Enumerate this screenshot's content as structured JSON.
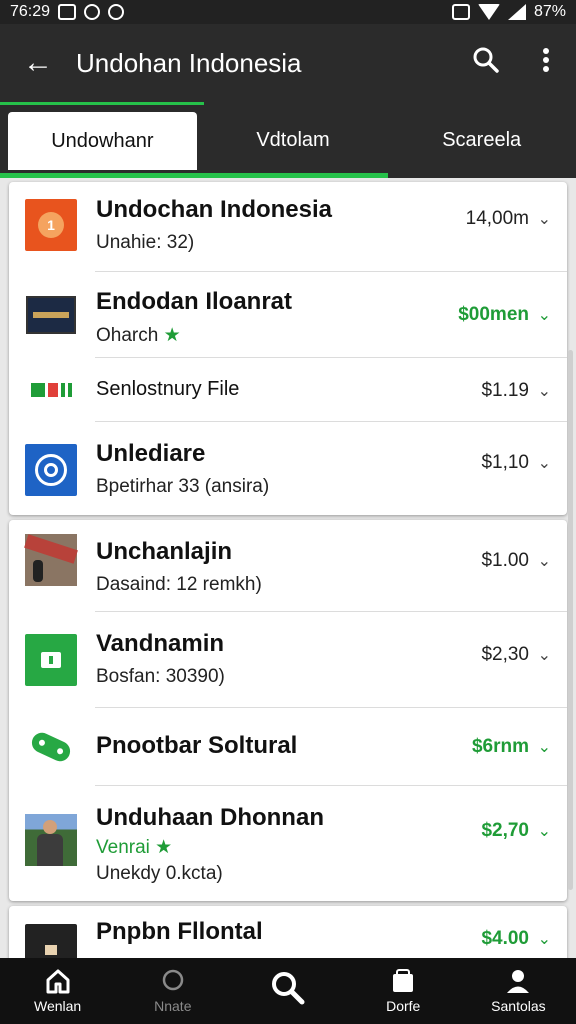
{
  "status": {
    "time": "76:29",
    "battery": "87%"
  },
  "appbar": {
    "title": "Undohan Indonesia"
  },
  "tabs": [
    {
      "label": "Undowhanr"
    },
    {
      "label": "Vdtolam"
    },
    {
      "label": "Scareela"
    }
  ],
  "card1": [
    {
      "name": "Undochan Indonesia",
      "sub": "Unahie: 32)",
      "price": "14,00m",
      "price_color": "normal"
    },
    {
      "name": "Endodan Iloanrat",
      "sub": "Oharch",
      "star": "★",
      "price": "$00men",
      "price_color": "green"
    },
    {
      "name": "Senlostnury File",
      "price": "$1.19",
      "price_color": "normal"
    },
    {
      "name": "Unlediare",
      "sub": "Bpetirhar 33 (ansira)",
      "price": "$1,10",
      "price_color": "normal"
    }
  ],
  "card2": [
    {
      "name": "Unchanlajin",
      "sub": "Dasaind: 12 remkh)",
      "price": "$1.00",
      "price_color": "normal"
    },
    {
      "name": "Vandnamin",
      "sub": "Bosfan: 30390)",
      "price": "$2,30",
      "price_color": "normal"
    },
    {
      "name": "Pnootbar Soltural",
      "price": "$6rnm",
      "price_color": "green"
    },
    {
      "name": "Unduhaan Dhonnan",
      "sub": "Venrai",
      "star": "★",
      "sub2": "Unekdy 0.kcta)",
      "price": "$2,70",
      "price_color": "green"
    }
  ],
  "card3": [
    {
      "name": "Pnpbn Fllontal",
      "price": "$4.00",
      "price_color": "green"
    }
  ],
  "bottom_nav": [
    {
      "label": "Wenlan",
      "icon": "home-icon"
    },
    {
      "label": "Nnate",
      "icon": "circle-icon"
    },
    {
      "label": "",
      "icon": "search-icon"
    },
    {
      "label": "Dorfe",
      "icon": "bag-icon"
    },
    {
      "label": "Santolas",
      "icon": "person-icon"
    }
  ]
}
